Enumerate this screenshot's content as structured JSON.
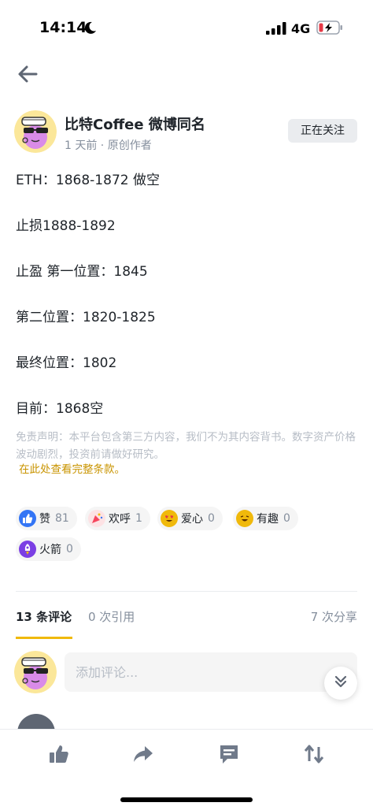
{
  "status_bar": {
    "time": "14:14",
    "network": "4G"
  },
  "author": {
    "name": "比特Coffee 微博同名",
    "meta": "1 天前 · 原创作者",
    "follow_label": "正在关注"
  },
  "post": {
    "lines": [
      "ETH：1868-1872 做空",
      "止损1888-1892",
      "止盈 第一位置：1845",
      "第二位置：1820-1825",
      "最终位置：1802",
      "目前：1868空"
    ],
    "disclaimer": "免责声明：本平台包含第三方内容，我们不为其内容背书。数字资产价格波动剧烈，投资前请做好研究。",
    "terms_link": "在此处查看完整条款。"
  },
  "reactions": [
    {
      "label": "赞",
      "count": "81",
      "icon": "thumbs-up-icon",
      "color": "#3375f5"
    },
    {
      "label": "欢呼",
      "count": "1",
      "icon": "party-popper-icon",
      "color": "#f6465d"
    },
    {
      "label": "爱心",
      "count": "0",
      "icon": "heart-eyes-icon",
      "color": "#f0b90b"
    },
    {
      "label": "有趣",
      "count": "0",
      "icon": "laughing-face-icon",
      "color": "#f0b90b"
    },
    {
      "label": "火箭",
      "count": "0",
      "icon": "rocket-icon",
      "color": "#7b3fe4"
    }
  ],
  "tabs": {
    "comments": "13 条评论",
    "quotes": "0 次引用",
    "shares": "7 次分享"
  },
  "comment_box": {
    "placeholder": "添加评论..."
  },
  "actions": [
    "like-icon",
    "share-icon",
    "comment-icon",
    "repost-icon"
  ],
  "colors": {
    "accent": "#f0b90b",
    "link": "#c99400",
    "text_primary": "#1e2329",
    "text_secondary": "#848e9c"
  }
}
